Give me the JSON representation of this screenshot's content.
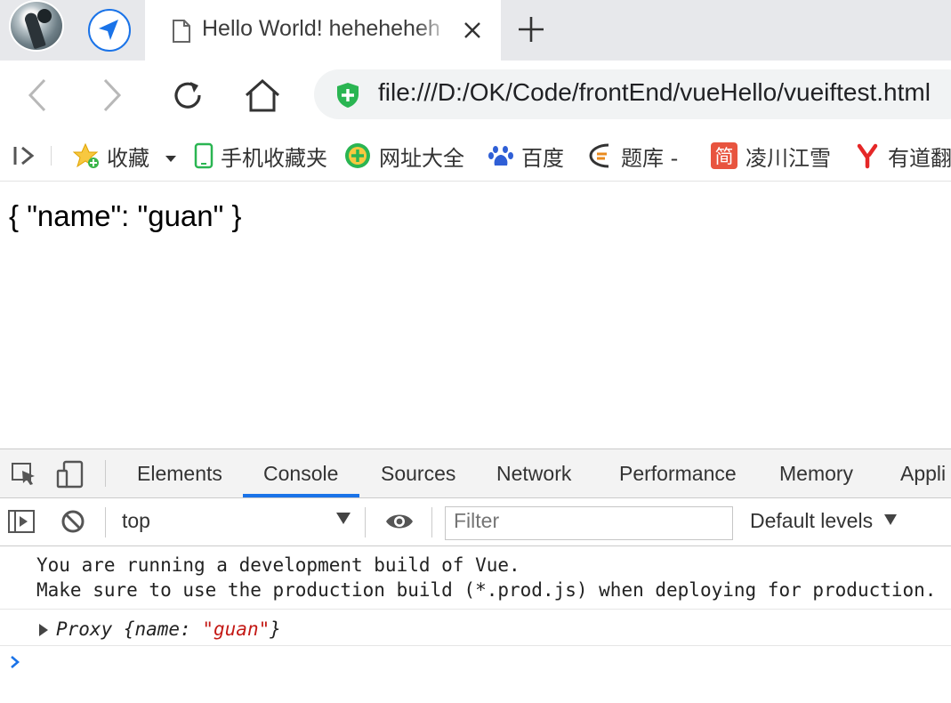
{
  "browser": {
    "tab_title": "Hello World! heheheheh",
    "url": "file:///D:/OK/Code/frontEnd/vueHello/vueiftest.html"
  },
  "bookmarks": [
    {
      "label": "收藏",
      "icon": "star-icon"
    },
    {
      "label": "手机收藏夹",
      "icon": "phone-icon"
    },
    {
      "label": "网址大全",
      "icon": "web-directory-icon"
    },
    {
      "label": "百度",
      "icon": "baidu-paw-icon"
    },
    {
      "label": "题库 -",
      "icon": "tiku-icon"
    },
    {
      "label": "凌川江雪",
      "icon": "jian-icon"
    },
    {
      "label": "有道翻",
      "icon": "youdao-icon"
    }
  ],
  "page": {
    "output": "{ \"name\": \"guan\" }"
  },
  "devtools": {
    "tabs": [
      "Elements",
      "Console",
      "Sources",
      "Network",
      "Performance",
      "Memory",
      "Appli"
    ],
    "active_tab": "Console",
    "context": "top",
    "filter_placeholder": "Filter",
    "levels": "Default levels",
    "console": {
      "line1": "You are running a development build of Vue.",
      "line2": "Make sure to use the production build (*.prod.js) when deploying for production.",
      "proxy_prefix": "Proxy {name: ",
      "proxy_value": "\"guan\"",
      "proxy_suffix": "}"
    }
  },
  "colors": {
    "accent": "#1a73e8",
    "string": "#c41a16",
    "shield": "#2ab552"
  }
}
